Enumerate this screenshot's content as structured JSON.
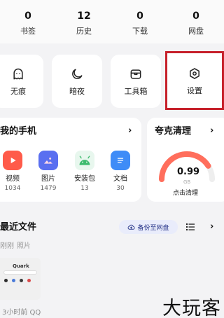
{
  "stats": [
    {
      "value": "0",
      "label": "书签"
    },
    {
      "value": "12",
      "label": "历史"
    },
    {
      "value": "0",
      "label": "下载"
    },
    {
      "value": "0",
      "label": "网盘"
    }
  ],
  "tools": [
    {
      "label": "无痕",
      "icon": "ghost-icon"
    },
    {
      "label": "暗夜",
      "icon": "moon-icon"
    },
    {
      "label": "工具箱",
      "icon": "toolbox-icon"
    },
    {
      "label": "设置",
      "icon": "settings-hexagon-icon"
    }
  ],
  "highlight_color": "#c6202a",
  "my_phone": {
    "title": "我的手机",
    "chevron": "›",
    "apps": [
      {
        "name": "视频",
        "count": "1034",
        "icon": "video-icon",
        "color": "#ff5b4a"
      },
      {
        "name": "图片",
        "count": "1479",
        "icon": "image-icon",
        "color": "#5a6ff0"
      },
      {
        "name": "安装包",
        "count": "13",
        "icon": "android-icon",
        "color": "#3dbb6e"
      },
      {
        "name": "文档",
        "count": "30",
        "icon": "document-icon",
        "color": "#3f8cf7"
      }
    ]
  },
  "cleaner": {
    "title": "夸克清理",
    "chevron": "›",
    "value": "0.99",
    "unit": "GB",
    "button": "点击清理",
    "level": 0.82
  },
  "recent": {
    "title": "最近文件",
    "backup_label": "备份至网盘",
    "tabs": [
      "刚刚",
      "照片"
    ],
    "thumb_text": "Quark",
    "file_meta": "3小时前  QQ"
  },
  "watermark": "大玩客"
}
